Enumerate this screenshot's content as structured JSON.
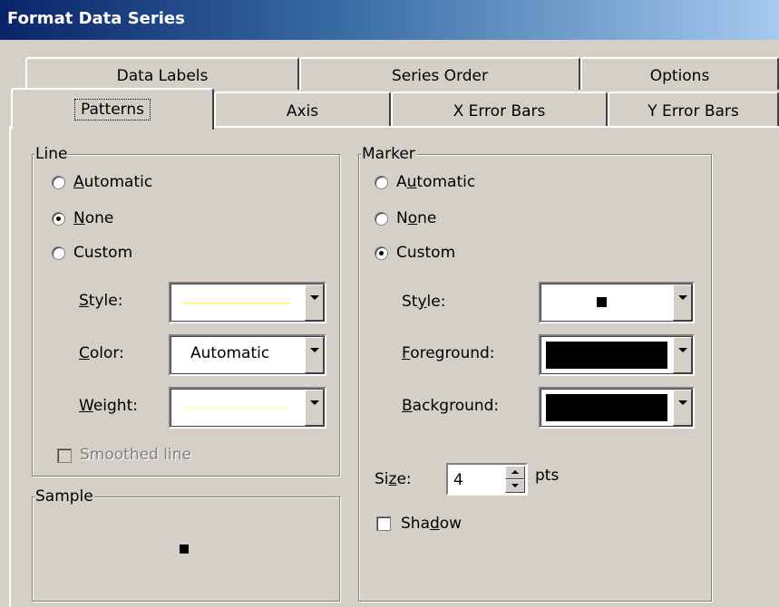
{
  "window": {
    "title": "Format Data Series"
  },
  "tabs": {
    "row_back": [
      "Data Labels",
      "Series Order",
      "Options"
    ],
    "row_front": [
      "Patterns",
      "Axis",
      "X Error Bars",
      "Y Error Bars"
    ],
    "selected": "Patterns"
  },
  "line_group": {
    "legend": "Line",
    "radios": [
      {
        "label": "Automatic",
        "accesskey": "A",
        "checked": false
      },
      {
        "label": "None",
        "accesskey": "N",
        "checked": true
      },
      {
        "label": "Custom",
        "accesskey": "",
        "checked": false
      }
    ],
    "style_label": "Style:",
    "color_label": "Color:",
    "color_value": "Automatic",
    "weight_label": "Weight:",
    "smoothed_label": "Smoothed line",
    "line_color": "#ffff00"
  },
  "sample_group": {
    "legend": "Sample"
  },
  "marker_group": {
    "legend": "Marker",
    "radios": [
      {
        "label": "Automatic",
        "checked": false
      },
      {
        "label": "None",
        "checked": false
      },
      {
        "label": "Custom",
        "checked": true
      }
    ],
    "style_label": "Style:",
    "foreground_label": "Foreground:",
    "background_label": "Background:",
    "foreground_color": "#000000",
    "background_color": "#000000",
    "size_label": "Size:",
    "size_value": "4",
    "size_unit": "pts",
    "shadow_label": "Shadow"
  }
}
